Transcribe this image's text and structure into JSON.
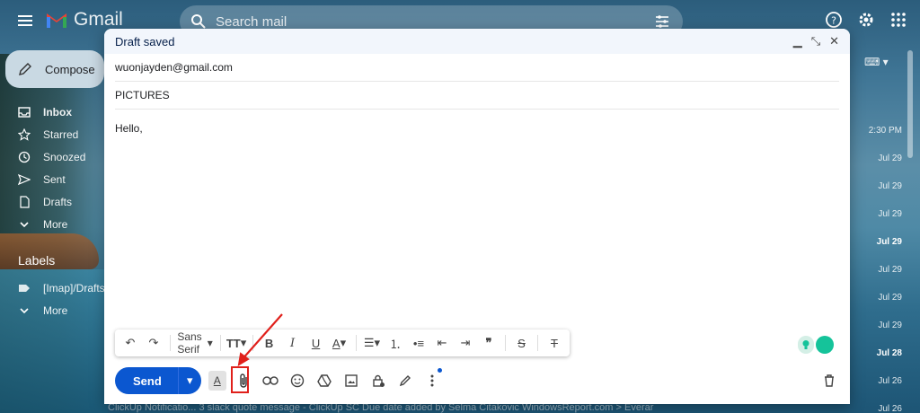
{
  "app": {
    "name": "Gmail"
  },
  "search": {
    "placeholder": "Search mail"
  },
  "sidebar": {
    "compose_label": "Compose",
    "items": [
      {
        "label": "Inbox",
        "icon": "inbox-icon"
      },
      {
        "label": "Starred",
        "icon": "star-icon"
      },
      {
        "label": "Snoozed",
        "icon": "clock-icon"
      },
      {
        "label": "Sent",
        "icon": "send-icon"
      },
      {
        "label": "Drafts",
        "icon": "draft-icon"
      },
      {
        "label": "More",
        "icon": "chevron-down-icon"
      }
    ],
    "labels_title": "Labels",
    "labels": [
      {
        "label": "[Imap]/Drafts",
        "icon": "label-icon"
      },
      {
        "label": "More",
        "icon": "chevron-down-icon"
      }
    ]
  },
  "email_list": {
    "dates": [
      {
        "text": "2:30 PM",
        "bold": false
      },
      {
        "text": "Jul 29",
        "bold": false
      },
      {
        "text": "Jul 29",
        "bold": false
      },
      {
        "text": "Jul 29",
        "bold": false
      },
      {
        "text": "Jul 29",
        "bold": true
      },
      {
        "text": "Jul 29",
        "bold": false
      },
      {
        "text": "Jul 29",
        "bold": false
      },
      {
        "text": "Jul 29",
        "bold": false
      },
      {
        "text": "Jul 28",
        "bold": true
      },
      {
        "text": "Jul 26",
        "bold": false
      },
      {
        "text": "Jul 26",
        "bold": false
      }
    ],
    "bottom_row": "ClickUp Notificatio...  3        slack quote message - ClickUp SC Due date added by Selma Citakovic WindowsReport.com > Everar"
  },
  "compose": {
    "title": "Draft saved",
    "to": "wuonjayden@gmail.com",
    "subject": "PICTURES",
    "body": "Hello,",
    "font": "Sans Serif",
    "send_label": "Send"
  },
  "colors": {
    "accent": "#0b57d0",
    "highlight": "#e0201b",
    "header_bg": "#f2f6fc"
  }
}
